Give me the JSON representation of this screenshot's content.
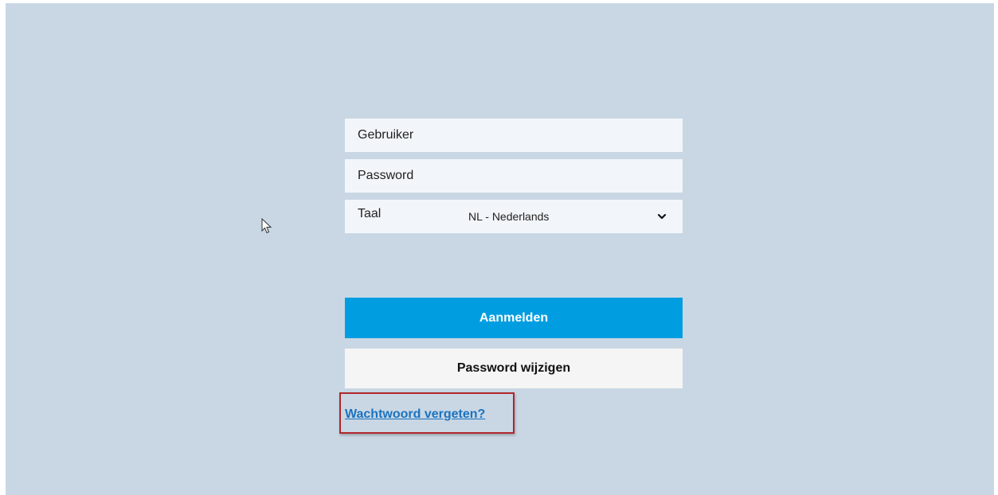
{
  "login": {
    "user_placeholder": "Gebruiker",
    "password_placeholder": "Password",
    "language_label": "Taal",
    "language_value": "NL - Nederlands",
    "login_button": "Aanmelden",
    "change_password_button": "Password wijzigen",
    "forgot_password_link": "Wachtwoord vergeten?"
  },
  "colors": {
    "background": "#c9d7e4",
    "field_background": "#f2f6fa",
    "primary_button": "#009de0",
    "secondary_button": "#f5f5f5",
    "link": "#1a73c0",
    "highlight_border": "#b0272b"
  },
  "icons": {
    "dropdown": "chevron-down-icon",
    "pointer": "mouse-cursor-icon"
  }
}
